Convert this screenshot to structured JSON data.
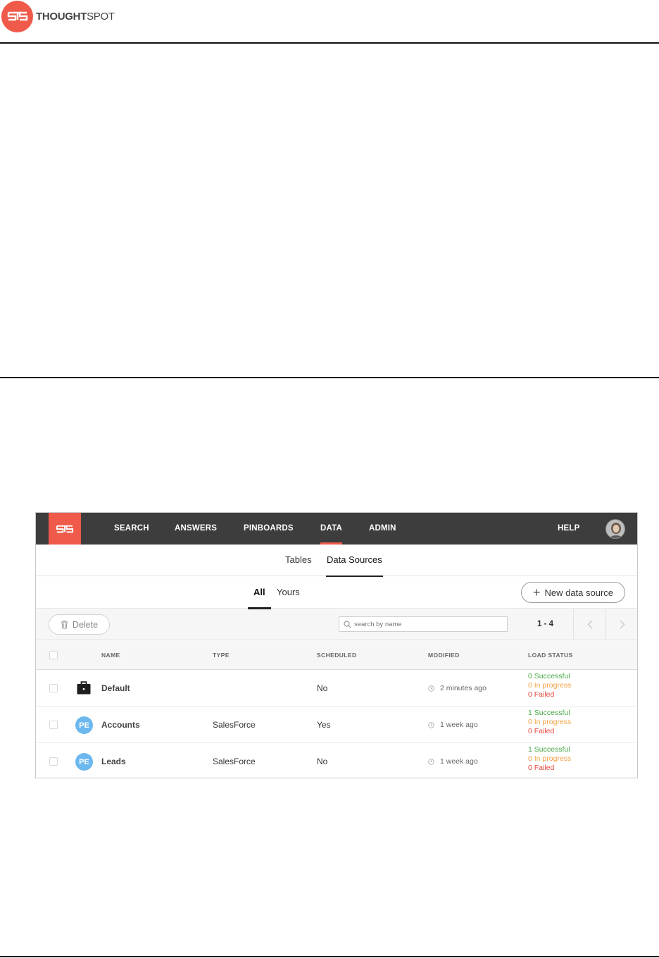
{
  "doc": {
    "logo_bold": "THOUGHT",
    "logo_light": "SPOT"
  },
  "app": {
    "nav": [
      {
        "label": "SEARCH"
      },
      {
        "label": "ANSWERS"
      },
      {
        "label": "PINBOARDS"
      },
      {
        "label": "DATA",
        "active": true
      },
      {
        "label": "ADMIN"
      }
    ],
    "help_label": "HELP",
    "subtabs": [
      {
        "label": "Tables"
      },
      {
        "label": "Data Sources",
        "active": true
      }
    ],
    "filters": [
      {
        "label": "All",
        "active": true
      },
      {
        "label": "Yours"
      }
    ],
    "new_source_label": "New data source",
    "delete_label": "Delete",
    "search_placeholder": "search by name",
    "pager": "1 - 4",
    "columns": {
      "name": "NAME",
      "type": "TYPE",
      "scheduled": "SCHEDULED",
      "modified": "MODIFIED",
      "load_status": "LOAD STATUS"
    },
    "rows": [
      {
        "icon": "briefcase-icon",
        "name": "Default",
        "type": "",
        "scheduled": "No",
        "modified": "2 minutes ago",
        "successful": "0 Successful",
        "in_progress": "0 In progress",
        "failed": "0 Failed"
      },
      {
        "icon": "PE",
        "name": "Accounts",
        "type": "SalesForce",
        "scheduled": "Yes",
        "modified": "1 week ago",
        "successful": "1 Successful",
        "in_progress": "0 In progress",
        "failed": "0 Failed"
      },
      {
        "icon": "PE",
        "name": "Leads",
        "type": "SalesForce",
        "scheduled": "No",
        "modified": "1 week ago",
        "successful": "1 Successful",
        "in_progress": "0 In progress",
        "failed": "0 Failed"
      }
    ],
    "colors": {
      "brand": "#ef5a4a",
      "nav_bg": "#3d3d3d",
      "success": "#4aa847",
      "progress": "#f5a144",
      "failed": "#e8463d",
      "badge": "#6cb8ee"
    }
  }
}
